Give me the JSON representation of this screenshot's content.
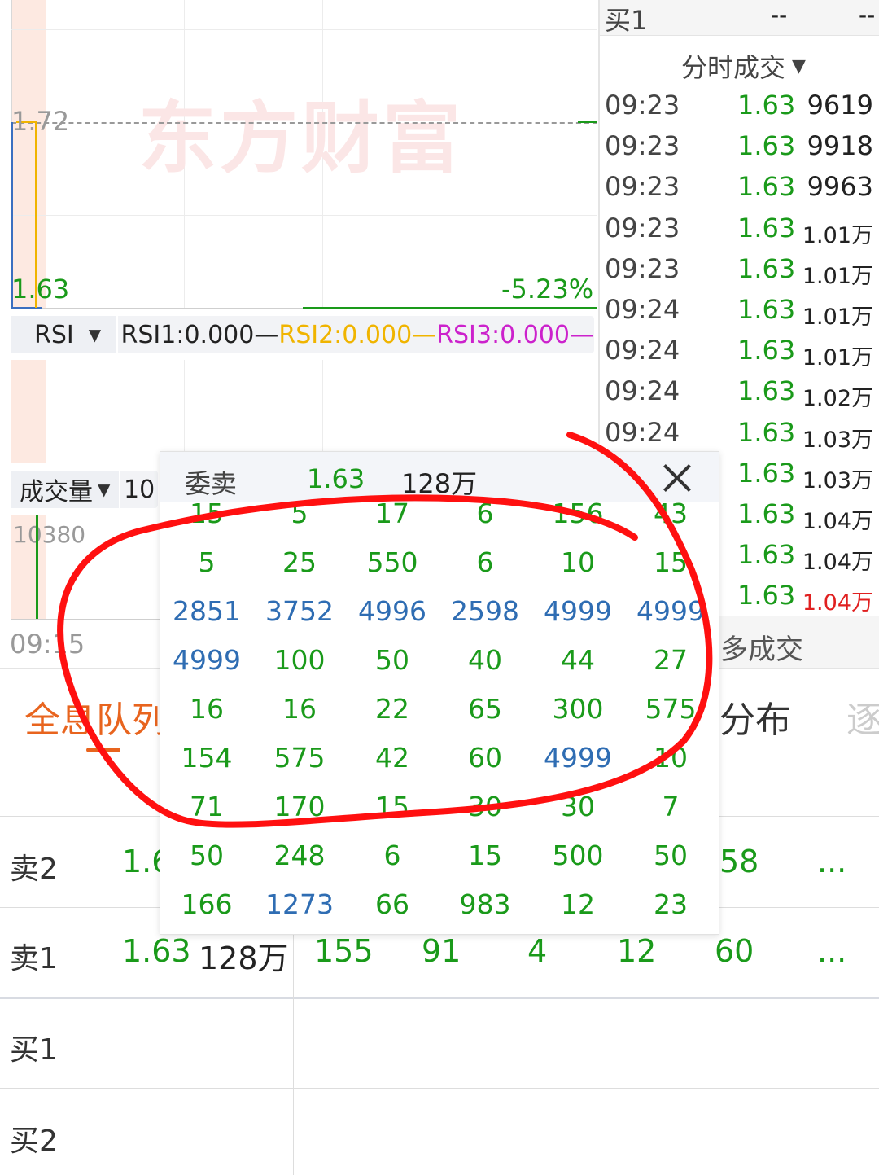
{
  "chart": {
    "price_top": "1.72",
    "price_bottom": "1.63",
    "pct_change": "-5.23%",
    "watermark": "东方财富",
    "rsi": {
      "selector": "RSI",
      "rsi1": "RSI1:0.000—",
      "rsi2": "RSI2:0.000—",
      "rsi3": "RSI3:0.000—",
      "rsi2_color": "#f0b400",
      "rsi3_color": "#cc22cc"
    },
    "volume": {
      "selector": "成交量",
      "value_partial": "10",
      "axis_max": "10380"
    },
    "time_start": "09:15"
  },
  "right_panel": {
    "top_label": "买1",
    "top_v1": "--",
    "top_v2": "--",
    "header": "分时成交",
    "trades": [
      {
        "time": "09:23",
        "price": "1.63",
        "vol": "9619",
        "small": false,
        "red": false
      },
      {
        "time": "09:23",
        "price": "1.63",
        "vol": "9918",
        "small": false,
        "red": false
      },
      {
        "time": "09:23",
        "price": "1.63",
        "vol": "9963",
        "small": false,
        "red": false
      },
      {
        "time": "09:23",
        "price": "1.63",
        "vol": "1.01万",
        "small": true,
        "red": false
      },
      {
        "time": "09:23",
        "price": "1.63",
        "vol": "1.01万",
        "small": true,
        "red": false
      },
      {
        "time": "09:24",
        "price": "1.63",
        "vol": "1.01万",
        "small": true,
        "red": false
      },
      {
        "time": "09:24",
        "price": "1.63",
        "vol": "1.01万",
        "small": true,
        "red": false
      },
      {
        "time": "09:24",
        "price": "1.63",
        "vol": "1.02万",
        "small": true,
        "red": false
      },
      {
        "time": "09:24",
        "price": "1.63",
        "vol": "1.03万",
        "small": true,
        "red": false
      },
      {
        "time": "",
        "price": "1.63",
        "vol": "1.03万",
        "small": true,
        "red": false
      },
      {
        "time": "",
        "price": "1.63",
        "vol": "1.04万",
        "small": true,
        "red": false
      },
      {
        "time": "",
        "price": "1.63",
        "vol": "1.04万",
        "small": true,
        "red": false
      },
      {
        "time": "",
        "price": "1.63",
        "vol": "1.04万",
        "small": true,
        "red": true
      }
    ],
    "more_label": "多成交"
  },
  "tabs": {
    "full_queue": "全息队列",
    "distribution": "分布",
    "next": "逐"
  },
  "queue": {
    "rows": [
      {
        "label": "卖2",
        "price": "1.6",
        "vol": "",
        "cells": [
          "",
          "",
          "",
          "",
          "",
          "58",
          "..."
        ]
      },
      {
        "label": "卖1",
        "price": "1.63",
        "vol": "128万",
        "cells": [
          "155",
          "91",
          "4",
          "12",
          "60",
          "..."
        ]
      },
      {
        "label": "买1",
        "price": "",
        "vol": "",
        "cells": []
      },
      {
        "label": "买2",
        "price": "",
        "vol": "",
        "cells": []
      }
    ]
  },
  "popup": {
    "title": "委卖",
    "price": "1.63",
    "volume": "128万",
    "grid": [
      [
        [
          "15",
          "g"
        ],
        [
          "5",
          "g"
        ],
        [
          "17",
          "g"
        ],
        [
          "6",
          "g"
        ],
        [
          "156",
          "g"
        ],
        [
          "43",
          "g"
        ]
      ],
      [
        [
          "5",
          "g"
        ],
        [
          "25",
          "g"
        ],
        [
          "550",
          "g"
        ],
        [
          "6",
          "g"
        ],
        [
          "10",
          "g"
        ],
        [
          "15",
          "g"
        ]
      ],
      [
        [
          "2851",
          "b"
        ],
        [
          "3752",
          "b"
        ],
        [
          "4996",
          "b"
        ],
        [
          "2598",
          "b"
        ],
        [
          "4999",
          "b"
        ],
        [
          "4999",
          "b"
        ]
      ],
      [
        [
          "4999",
          "b"
        ],
        [
          "100",
          "g"
        ],
        [
          "50",
          "g"
        ],
        [
          "40",
          "g"
        ],
        [
          "44",
          "g"
        ],
        [
          "27",
          "g"
        ]
      ],
      [
        [
          "16",
          "g"
        ],
        [
          "16",
          "g"
        ],
        [
          "22",
          "g"
        ],
        [
          "65",
          "g"
        ],
        [
          "300",
          "g"
        ],
        [
          "575",
          "g"
        ]
      ],
      [
        [
          "154",
          "g"
        ],
        [
          "575",
          "g"
        ],
        [
          "42",
          "g"
        ],
        [
          "60",
          "g"
        ],
        [
          "4999",
          "b"
        ],
        [
          "10",
          "g"
        ]
      ],
      [
        [
          "71",
          "g"
        ],
        [
          "170",
          "g"
        ],
        [
          "15",
          "g"
        ],
        [
          "30",
          "g"
        ],
        [
          "30",
          "g"
        ],
        [
          "7",
          "g"
        ]
      ],
      [
        [
          "50",
          "g"
        ],
        [
          "248",
          "g"
        ],
        [
          "6",
          "g"
        ],
        [
          "15",
          "g"
        ],
        [
          "500",
          "g"
        ],
        [
          "50",
          "g"
        ]
      ],
      [
        [
          "166",
          "g"
        ],
        [
          "1273",
          "b"
        ],
        [
          "66",
          "g"
        ],
        [
          "983",
          "g"
        ],
        [
          "12",
          "g"
        ],
        [
          "23",
          "g"
        ]
      ]
    ]
  },
  "colors": {
    "green": "#1a9a1a",
    "blue": "#2f6db3",
    "red": "#e02020",
    "accent_tab": "#e8641e",
    "annotation": "#ff1010"
  }
}
